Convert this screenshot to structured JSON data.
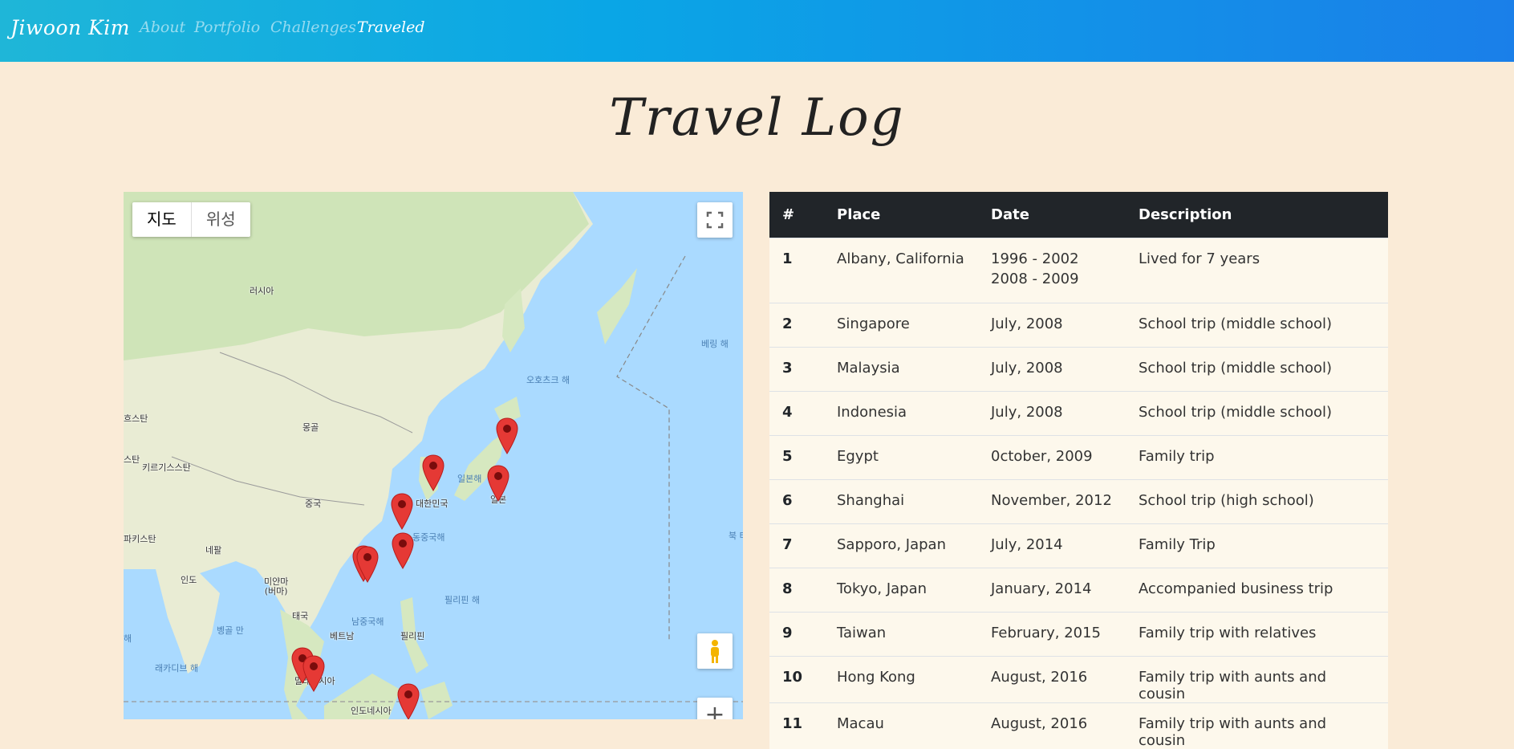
{
  "nav": {
    "brand": "Jiwoon Kim",
    "links": [
      "About",
      "Portfolio",
      "Challenges",
      "Traveled"
    ],
    "active": "Traveled"
  },
  "page_title": "Travel Log",
  "map": {
    "type_buttons": [
      "지도",
      "위성"
    ],
    "selected_type": "지도",
    "labels": {
      "russia": "러시아",
      "mongolia": "몽골",
      "china": "중국",
      "korea": "대한민국",
      "japan": "일본",
      "sea_of_japan": "일본해",
      "okhotsk": "오호츠크 해",
      "bering": "베링 해",
      "east_china_sea": "동중국해",
      "philippine_sea": "필리핀 해",
      "south_china_sea": "남중국해",
      "philippines": "필리핀",
      "vietnam": "베트남",
      "thailand": "태국",
      "myanmar": "미얀마\n(버마)",
      "india": "인도",
      "nepal": "네팔",
      "bay_of_bengal": "벵골 만",
      "laccadive": "래카디브 해",
      "malaysia": "말레이시아",
      "indonesia": "인도네시아",
      "kazakhstan": "흐스탄",
      "kyrgyzstan": "키르기스스탄",
      "tajikistan": "스탄",
      "pakistan": "파키스탄",
      "arab": "해",
      "north": "북 태"
    },
    "icons": [
      "fullscreen-icon",
      "pegman-icon",
      "zoom-in-icon",
      "map-marker-icon"
    ]
  },
  "table": {
    "headers": [
      "#",
      "Place",
      "Date",
      "Description"
    ],
    "rows": [
      {
        "num": "1",
        "place": "Albany, California",
        "date": "1996 - 2002",
        "date2": "2008 - 2009",
        "desc": "Lived for 7 years"
      },
      {
        "num": "2",
        "place": "Singapore",
        "date": "July, 2008",
        "desc": "School trip (middle school)"
      },
      {
        "num": "3",
        "place": "Malaysia",
        "date": "July, 2008",
        "desc": "School trip (middle school)"
      },
      {
        "num": "4",
        "place": "Indonesia",
        "date": "July, 2008",
        "desc": "School trip (middle school)"
      },
      {
        "num": "5",
        "place": "Egypt",
        "date": "0ctober, 2009",
        "desc": "Family trip"
      },
      {
        "num": "6",
        "place": "Shanghai",
        "date": "November, 2012",
        "desc": "School trip (high school)"
      },
      {
        "num": "7",
        "place": "Sapporo, Japan",
        "date": "July, 2014",
        "desc": "Family Trip"
      },
      {
        "num": "8",
        "place": "Tokyo, Japan",
        "date": "January, 2014",
        "desc": "Accompanied business trip"
      },
      {
        "num": "9",
        "place": "Taiwan",
        "date": "February, 2015",
        "desc": "Family trip with relatives"
      },
      {
        "num": "10",
        "place": "Hong Kong",
        "date": "August, 2016",
        "desc": "Family trip with aunts and cousin"
      },
      {
        "num": "11",
        "place": "Macau",
        "date": "August, 2016",
        "desc": "Family trip with aunts and cousin"
      }
    ]
  },
  "colors": {
    "page_bg": "#faebd7",
    "nav_start": "#1fb6d8",
    "nav_end": "#1a7fe9",
    "table_head": "#212529",
    "marker": "#e53935",
    "ocean": "#aadaff",
    "land": "#e8ead2",
    "forest": "#cde4b8"
  }
}
